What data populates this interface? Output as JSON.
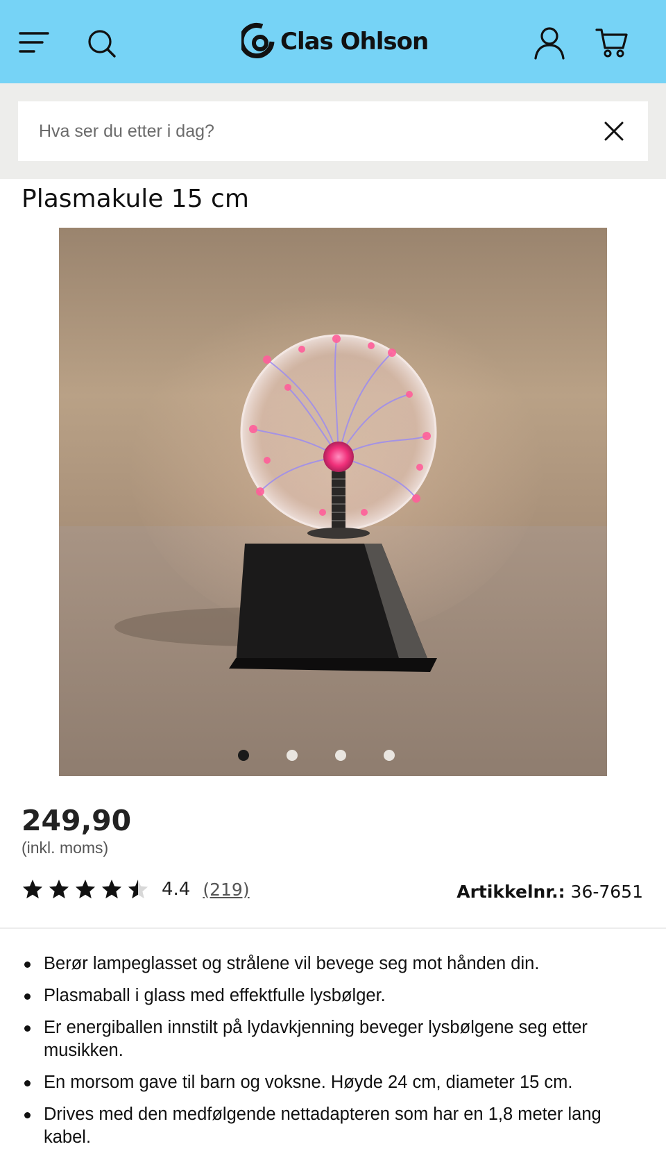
{
  "header": {
    "brand": "Clas Ohlson",
    "icons": {
      "menu": "menu-icon",
      "search": "search-icon",
      "account": "user-icon",
      "cart": "cart-icon",
      "logo": "clas-ohlson-logo-icon"
    },
    "background_color": "#76d3f6"
  },
  "search": {
    "placeholder": "Hva ser du etter i dag?",
    "value": "",
    "clear_icon": "close-icon"
  },
  "product": {
    "title": "Plasmakule 15 cm",
    "gallery": {
      "image": "plasma-ball-photo",
      "slide_count": 4,
      "active_slide": 1
    },
    "price": "249,90",
    "vat_note": "(inkl. moms)",
    "rating": {
      "value": "4.4",
      "count": "(219)",
      "stars_fraction": 0.88
    },
    "sku_label": "Artikkelnr.:",
    "sku_value": " 36-7651",
    "features": [
      "Berør lampeglasset og strålene vil bevege seg mot hånden din.",
      "Plasmaball i glass med effektfulle lysbølger.",
      "Er energiballen innstilt på lydavkjenning beveger lysbølgene seg etter musikken.",
      "En morsom gave til barn og voksne. Høyde 24 cm, diameter 15 cm.",
      "Drives med den medfølgende nettadapteren som har en 1,8 meter lang kabel."
    ]
  }
}
